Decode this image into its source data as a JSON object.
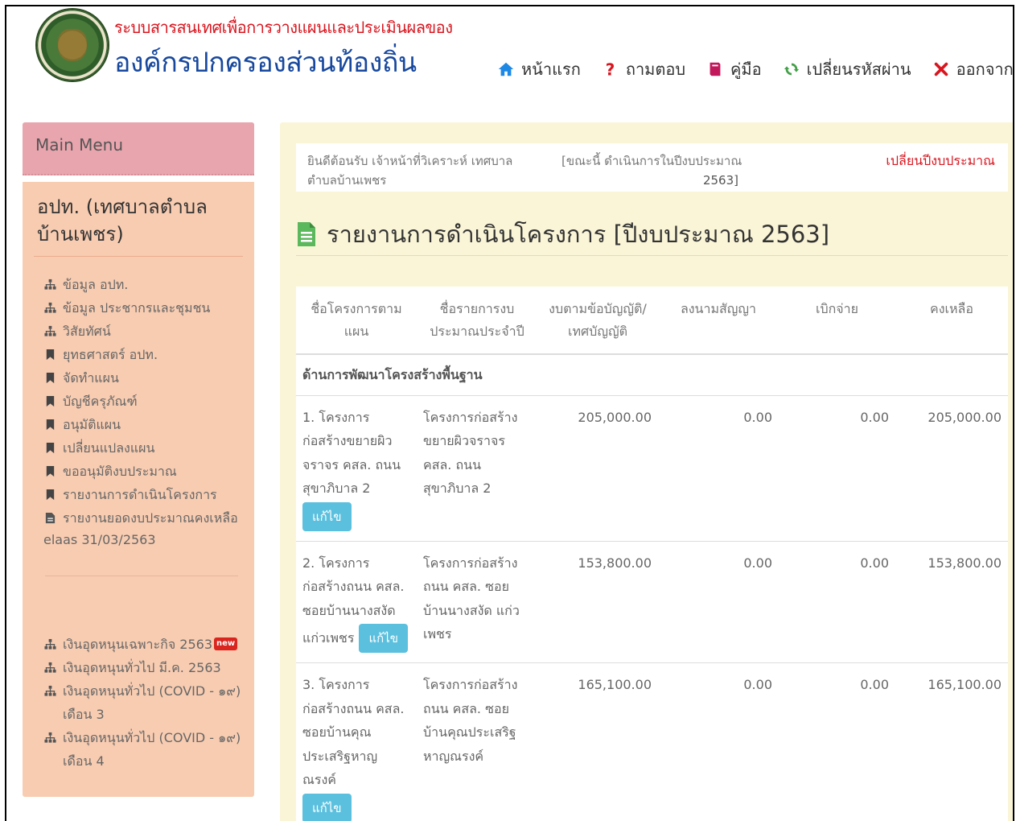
{
  "header": {
    "brand_top": "ระบบสารสนเทศเพื่อการวางแผนและประเมินผลของ",
    "brand_main": "องค์กรปกครองส่วนท้องถิ่น",
    "nav": [
      {
        "label": "หน้าแรก",
        "icon": "home-icon",
        "color": "#1e88e5"
      },
      {
        "label": "ถามตอบ",
        "icon": "question-icon",
        "color": "#d8161f"
      },
      {
        "label": "คู่มือ",
        "icon": "book-icon",
        "color": "#c2185b"
      },
      {
        "label": "เปลี่ยนรหัสผ่าน",
        "icon": "refresh-icon",
        "color": "#43a047"
      },
      {
        "label": "ออกจากระบบ",
        "icon": "close-icon",
        "color": "#d8161f"
      }
    ]
  },
  "sidebar": {
    "main_menu_label": "Main Menu",
    "org_title": "อปท. (เทศบาลตำบลบ้านเพชร)",
    "items": [
      {
        "label": "ข้อมูล อปท.",
        "icon": "sitemap-icon"
      },
      {
        "label": "ข้อมูล ประชากรและชุมชน",
        "icon": "sitemap-icon"
      },
      {
        "label": "วิสัยทัศน์",
        "icon": "sitemap-icon"
      },
      {
        "label": "ยุทธศาสตร์ อปท.",
        "icon": "bookmark-icon"
      },
      {
        "label": "จัดทำแผน",
        "icon": "bookmark-icon"
      },
      {
        "label": "บัญชีครุภัณฑ์",
        "icon": "bookmark-icon"
      },
      {
        "label": "อนุมัติแผน",
        "icon": "bookmark-icon"
      },
      {
        "label": "เปลี่ยนแปลงแผน",
        "icon": "bookmark-icon"
      },
      {
        "label": "ขออนุมัติงบประมาณ",
        "icon": "bookmark-icon"
      },
      {
        "label": "รายงานการดำเนินโครงการ",
        "icon": "bookmark-icon"
      },
      {
        "label": "รายงานยอดงบประมาณคงเหลือ",
        "icon": "file-icon"
      }
    ],
    "extra_text": "elaas 31/03/2563",
    "subsidy_items": [
      {
        "label": "เงินอุดหนุนเฉพาะกิจ 2563",
        "badge": "new"
      },
      {
        "label": "เงินอุดหนุนทั่วไป มี.ค. 2563",
        "badge": ""
      },
      {
        "label": "เงินอุดหนุนทั่วไป (COVID - ๑๙) เดือน 3",
        "badge": ""
      },
      {
        "label": "เงินอุดหนุนทั่วไป (COVID - ๑๙) เดือน 4",
        "badge": ""
      }
    ]
  },
  "welcome": {
    "user_text": "ยินดีต้อนรับ เจ้าหน้าที่วิเคราะห์ เทศบาลตำบลบ้านเพชร",
    "status_text": "[ขณะนี้ ดำเนินการในปีงบประมาณ",
    "status_year": "2563]",
    "change_year_link": "เปลี่ยนปีงบประมาณ"
  },
  "page": {
    "title": "รายงานการดำเนินโครงการ [ปีงบประมาณ 2563]"
  },
  "table": {
    "headers": [
      "ชื่อโครงการตามแผน",
      "ชื่อรายการงบประมาณประจำปี",
      "งบตามข้อบัญญัติ/เทศบัญญัติ",
      "ลงนามสัญญา",
      "เบิกจ่าย",
      "คงเหลือ"
    ],
    "section": "ด้านการพัฒนาโครงสร้างพื้นฐาน",
    "edit_label": "แก้ไข",
    "rows": [
      {
        "plan": "1. โครงการก่อสร้างขยายผิวจราจร คสล. ถนนสุขาภิบาล 2",
        "budget_item": "โครงการก่อสร้างขยายผิวจราจร คสล. ถนนสุขาภิบาล 2",
        "budget": "205,000.00",
        "contract": "0.00",
        "disbursed": "0.00",
        "remaining": "205,000.00"
      },
      {
        "plan": "2. โครงการก่อสร้างถนน คสล. ซอยบ้านนางสงัด แก่วเพชร",
        "budget_item": "โครงการก่อสร้างถนน คสล. ซอยบ้านนางสงัด แก่วเพชร",
        "budget": "153,800.00",
        "contract": "0.00",
        "disbursed": "0.00",
        "remaining": "153,800.00"
      },
      {
        "plan": "3. โครงการก่อสร้างถนน คสล. ซอยบ้านคุณประเสริฐหาญณรงค์",
        "budget_item": "โครงการก่อสร้างถนน คสล. ซอยบ้านคุณประเสริฐหาญณรงค์",
        "budget": "165,100.00",
        "contract": "0.00",
        "disbursed": "0.00",
        "remaining": "165,100.00"
      }
    ]
  }
}
